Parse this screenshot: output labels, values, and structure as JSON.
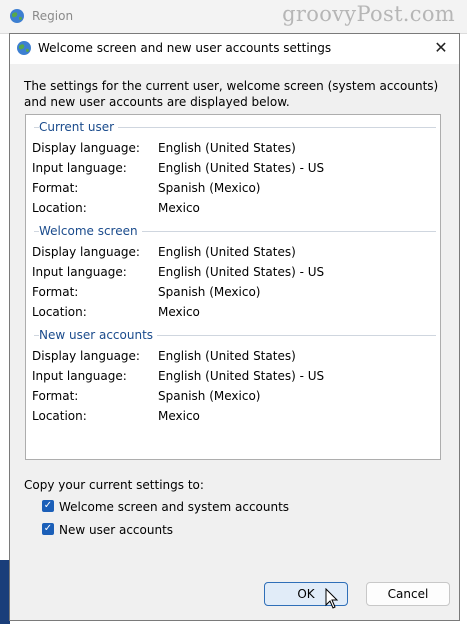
{
  "parent_window": {
    "title": "Region"
  },
  "watermark": "groovyPost.com",
  "dialog": {
    "title": "Welcome screen and new user accounts settings",
    "close_glyph": "✕",
    "description": "The settings for the current user, welcome screen (system accounts) and new user accounts are displayed below.",
    "groups": [
      {
        "header": "Current user",
        "rows": [
          {
            "label": "Display language:",
            "value": "English (United States)"
          },
          {
            "label": "Input language:",
            "value": "English (United States) - US"
          },
          {
            "label": "Format:",
            "value": "Spanish (Mexico)"
          },
          {
            "label": "Location:",
            "value": "Mexico"
          }
        ]
      },
      {
        "header": "Welcome screen",
        "rows": [
          {
            "label": "Display language:",
            "value": "English (United States)"
          },
          {
            "label": "Input language:",
            "value": "English (United States) - US"
          },
          {
            "label": "Format:",
            "value": "Spanish (Mexico)"
          },
          {
            "label": "Location:",
            "value": "Mexico"
          }
        ]
      },
      {
        "header": "New user accounts",
        "rows": [
          {
            "label": "Display language:",
            "value": "English (United States)"
          },
          {
            "label": "Input language:",
            "value": "English (United States) - US"
          },
          {
            "label": "Format:",
            "value": "Spanish (Mexico)"
          },
          {
            "label": "Location:",
            "value": "Mexico"
          }
        ]
      }
    ],
    "copy_label": "Copy your current settings to:",
    "checkboxes": [
      {
        "label": "Welcome screen and system accounts",
        "checked": true
      },
      {
        "label": "New user accounts",
        "checked": true
      }
    ],
    "ok_label": "OK",
    "cancel_label": "Cancel"
  },
  "colors": {
    "accent": "#1b5fb8",
    "group_header": "#1a4b8c"
  }
}
